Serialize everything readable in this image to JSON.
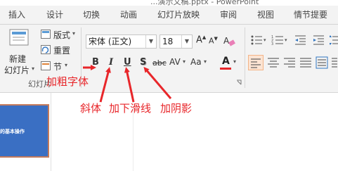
{
  "window_title": "...演示文稿.pptx - PowerPoint",
  "tabs": [
    "插入",
    "设计",
    "切换",
    "动画",
    "幻灯片放映",
    "审阅",
    "视图",
    "情节提要"
  ],
  "slides_group": {
    "new_slide": "新建",
    "new_slide2": "幻灯片",
    "layout": "版式",
    "reset": "重置",
    "section": "节",
    "group_label": "幻灯片"
  },
  "font_group": {
    "font_name": "宋体 (正文)",
    "font_size": "18",
    "bold": "B",
    "italic": "I",
    "underline": "U",
    "shadow": "S",
    "strike": "abc",
    "spacing": "AV",
    "case": "Aa",
    "color": "A",
    "font_color": "#e8262a"
  },
  "annotations": {
    "bold": "加粗字体",
    "italic": "斜体",
    "underline": "加下滑线",
    "shadow": "加阴影"
  },
  "thumbnail": {
    "title": "的基本操作",
    "bg_color": "#3a6fc3"
  },
  "accent": "#e8262a"
}
